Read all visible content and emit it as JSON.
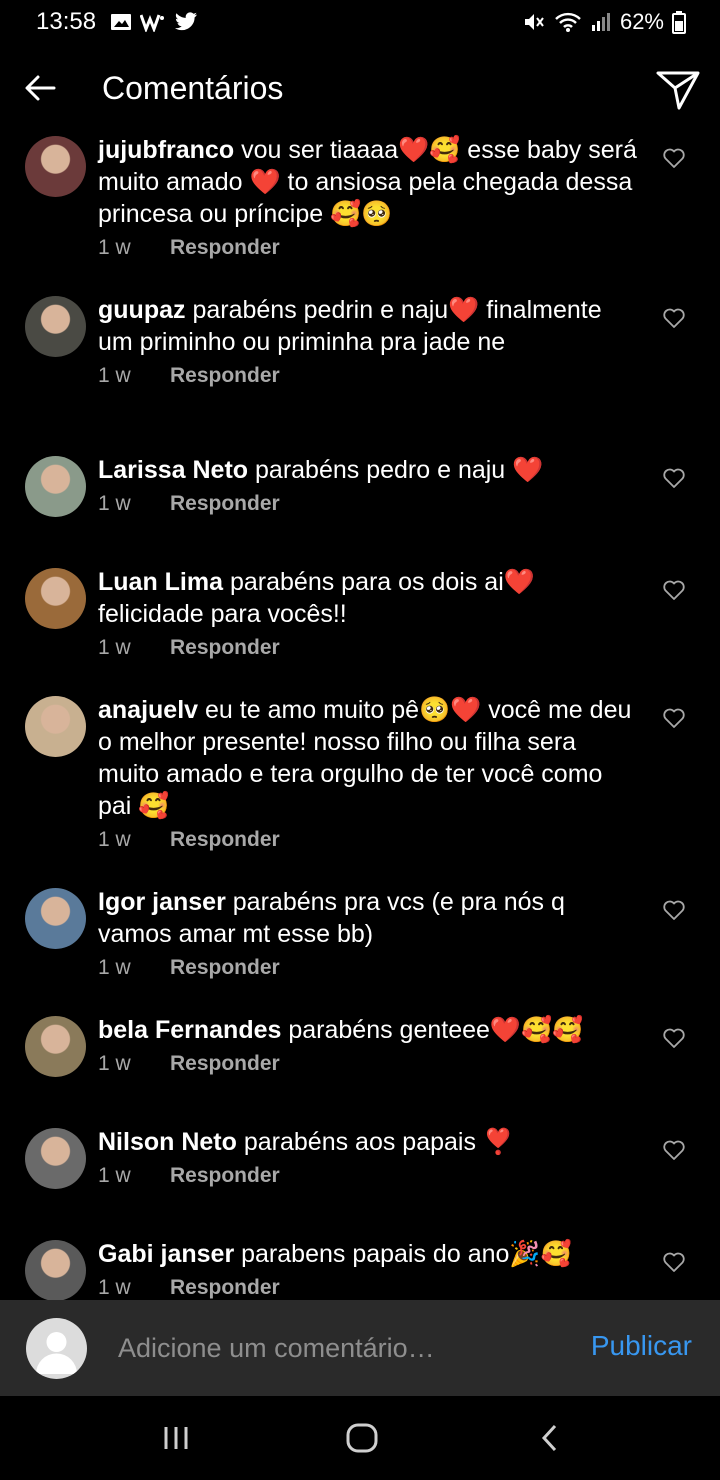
{
  "status_bar": {
    "time": "13:58",
    "battery": "62%",
    "icons": [
      "gallery-icon",
      "w-icon",
      "twitter-icon",
      "mute-icon",
      "wifi-icon",
      "signal-icon",
      "battery-icon"
    ]
  },
  "header": {
    "title": "Comentários"
  },
  "comments": [
    {
      "username": "jujubfranco",
      "text": "vou ser tiaaaa❤️🥰 esse baby será muito amado ❤️ to ansiosa pela chegada dessa princesa ou príncipe 🥰🥺",
      "time": "1 w",
      "reply": "Responder",
      "avatar_color": "#6b3a3a"
    },
    {
      "username": "guupaz",
      "text": "parabéns pedrin e naju❤️ finalmente um priminho ou priminha pra jade ne",
      "time": "1 w",
      "reply": "Responder",
      "avatar_color": "#4a4a44"
    },
    {
      "username": "Larissa Neto",
      "text": "parabéns pedro e naju ❤️",
      "time": "1 w",
      "reply": "Responder",
      "avatar_color": "#8a9a8a"
    },
    {
      "username": "Luan Lima",
      "text": "parabéns para os dois ai❤️ felicidade para vocês!!",
      "time": "1 w",
      "reply": "Responder",
      "avatar_color": "#9a6a3a"
    },
    {
      "username": "anajuelv",
      "text": "eu te amo muito pê🥺❤️ você me deu o melhor presente! nosso filho ou filha sera muito amado e tera orgulho de ter você como pai 🥰",
      "time": "1 w",
      "reply": "Responder",
      "avatar_color": "#c8b090"
    },
    {
      "username": "Igor janser",
      "text": "parabéns pra vcs (e pra nós q vamos amar mt esse bb)",
      "time": "1 w",
      "reply": "Responder",
      "avatar_color": "#5a7a9a"
    },
    {
      "username": "bela Fernandes",
      "text": "parabéns genteee❤️🥰🥰",
      "time": "1 w",
      "reply": "Responder",
      "avatar_color": "#8a7a5a"
    },
    {
      "username": "Nilson Neto",
      "text": "parabéns aos papais ❣️",
      "time": "1 w",
      "reply": "Responder",
      "avatar_color": "#6a6a6a"
    },
    {
      "username": "Gabi janser",
      "text": "parabens papais do ano🎉🥰",
      "time": "1 w",
      "reply": "Responder",
      "avatar_color": "#5a5a5a"
    }
  ],
  "add_comment": {
    "placeholder": "Adicione um comentário…",
    "publish_label": "Publicar"
  },
  "colors": {
    "background": "#000000",
    "meta_text": "#a8a8a8",
    "accent": "#3897f0",
    "input_bar": "#2a2a2a"
  }
}
